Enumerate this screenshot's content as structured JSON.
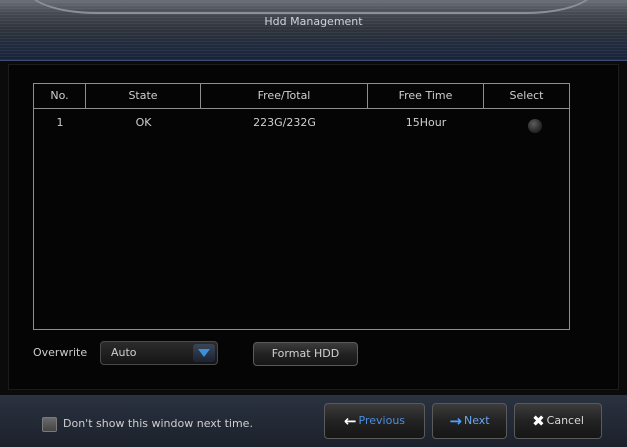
{
  "dialog": {
    "title": "Hdd Management"
  },
  "table": {
    "headers": [
      "No.",
      "State",
      "Free/Total",
      "Free Time",
      "Select"
    ],
    "rows": [
      {
        "no": "1",
        "state": "OK",
        "free_total": "223G/232G",
        "free_time": "15Hour",
        "selected": false
      }
    ]
  },
  "overwrite": {
    "label": "Overwrite",
    "value": "Auto"
  },
  "format_button": {
    "label": "Format HDD"
  },
  "footer": {
    "dont_show_label": "Don't show this window next time.",
    "dont_show_checked": false,
    "previous_label": "Previous",
    "next_label": "Next",
    "cancel_label": "Cancel"
  },
  "colors": {
    "accent": "#4aa3ff",
    "title_bar": "#1f2a3f",
    "border": "#8e8e8e"
  },
  "icons": {
    "previous": "arrow-left-icon",
    "next": "arrow-right-icon",
    "cancel": "close-icon",
    "dropdown": "chevron-down-icon"
  }
}
